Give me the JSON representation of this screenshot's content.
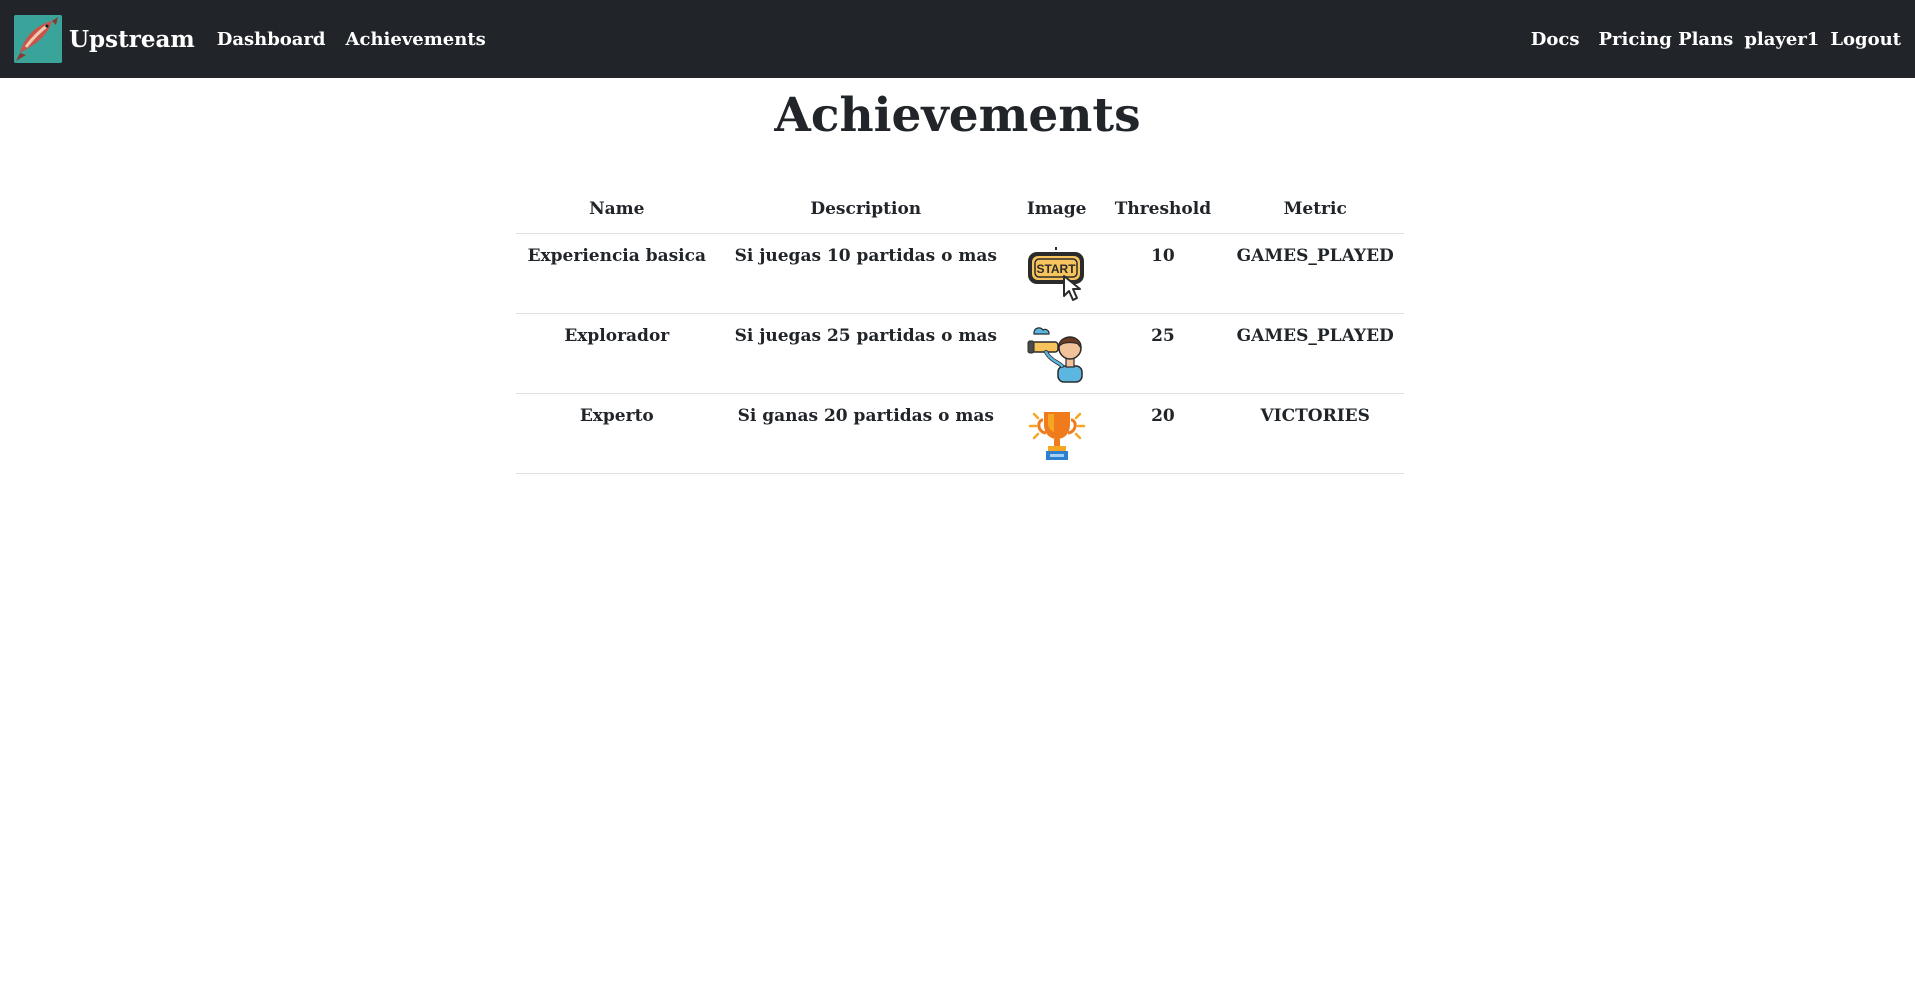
{
  "navbar": {
    "brand": "Upstream",
    "left_links": [
      "Dashboard",
      "Achievements"
    ],
    "docs": "Docs",
    "pricing": "Pricing Plans",
    "user": "player1",
    "logout": "Logout"
  },
  "page": {
    "title": "Achievements"
  },
  "table": {
    "headers": [
      "Name",
      "Description",
      "Image",
      "Threshold",
      "Metric"
    ],
    "rows": [
      {
        "name": "Experiencia basica",
        "description": "Si juegas 10 partidas o mas",
        "image": "start-button-icon",
        "threshold": "10",
        "metric": "GAMES_PLAYED"
      },
      {
        "name": "Explorador",
        "description": "Si juegas 25 partidas o mas",
        "image": "explorer-binoculars-icon",
        "threshold": "25",
        "metric": "GAMES_PLAYED"
      },
      {
        "name": "Experto",
        "description": "Si ganas 20 partidas o mas",
        "image": "trophy-icon",
        "threshold": "20",
        "metric": "VICTORIES"
      }
    ]
  },
  "colors": {
    "navbar_bg": "#212529",
    "logo_bg": "#3aa39a",
    "text": "#212529",
    "divider": "#dee2e6"
  }
}
